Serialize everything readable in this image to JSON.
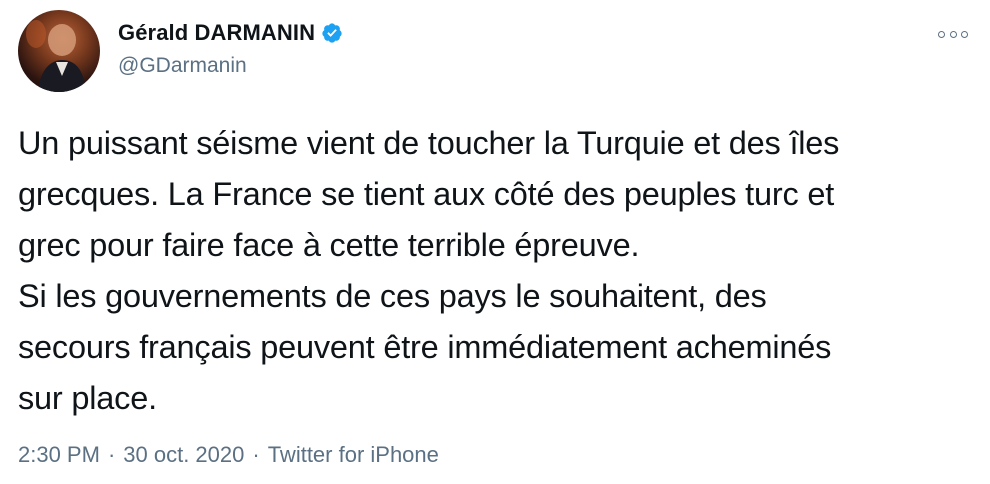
{
  "tweet": {
    "author": {
      "display_name": "Gérald DARMANIN",
      "handle": "@GDarmanin",
      "verified": true,
      "avatar_icon": "avatar-photo"
    },
    "text": "Un puissant séisme vient de toucher la Turquie et des îles\ngrecques. La France se tient aux côté des peuples turc et\ngrec pour faire face à cette terrible épreuve.\nSi les gouvernements de ces pays le souhaitent, des\nsecours français peuvent être immédiatement acheminés\nsur place.",
    "time": "2:30 PM",
    "date": "30 oct. 2020",
    "separator": "·",
    "source": "Twitter for iPhone",
    "more_icon": "more-options-icon"
  },
  "colors": {
    "text": "#0f1419",
    "secondary": "#5b7083",
    "verified": "#1da1f2",
    "background": "#ffffff"
  }
}
